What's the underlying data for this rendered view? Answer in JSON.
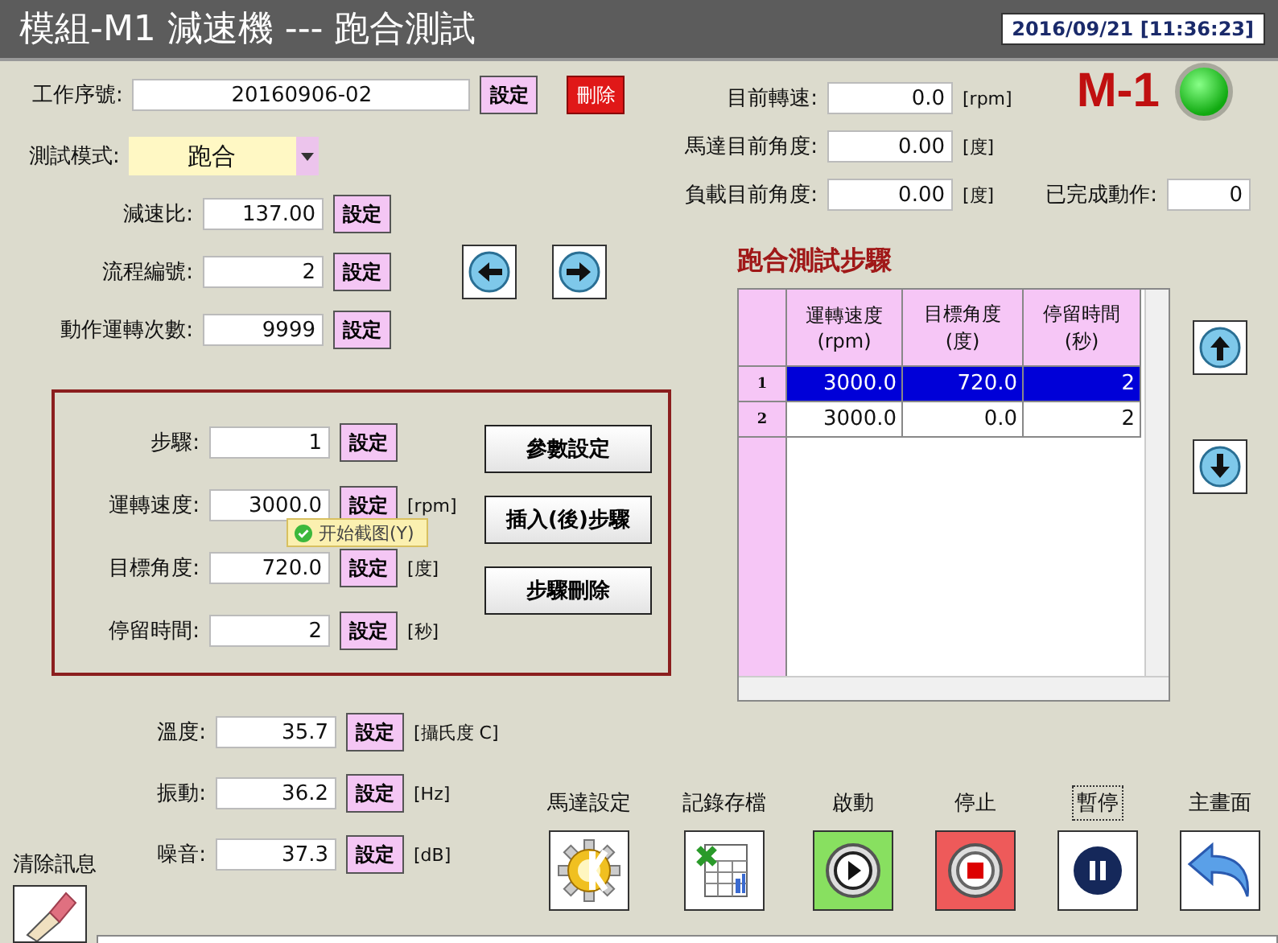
{
  "title": "模組-M1 減速機 --- 跑合測試",
  "datetime": "2016/09/21 [11:36:23]",
  "job": {
    "label": "工作序號:",
    "value": "20160906-02",
    "set_button": "設定",
    "delete_button": "刪除"
  },
  "mode": {
    "label": "測試模式:",
    "value": "跑合"
  },
  "params": [
    {
      "label": "減速比:",
      "value": "137.00",
      "button": "設定"
    },
    {
      "label": "流程編號:",
      "value": "2",
      "button": "設定"
    },
    {
      "label": "動作運轉次數:",
      "value": "9999",
      "button": "設定"
    }
  ],
  "step_box": {
    "fields": [
      {
        "label": "步驟:",
        "value": "1",
        "button": "設定"
      },
      {
        "label": "運轉速度:",
        "value": "3000.0",
        "button": "設定",
        "unit": "[rpm]"
      },
      {
        "label": "目標角度:",
        "value": "720.0",
        "button": "設定",
        "unit": "[度]"
      },
      {
        "label": "停留時間:",
        "value": "2",
        "button": "設定",
        "unit": "[秒]"
      }
    ],
    "buttons": [
      "參數設定",
      "插入(後)步驟",
      "步驟刪除"
    ],
    "tooltip": "开始截图(Y)"
  },
  "sensors": [
    {
      "label": "溫度:",
      "value": "35.7",
      "button": "設定",
      "unit": "[攝氏度 C]"
    },
    {
      "label": "振動:",
      "value": "36.2",
      "button": "設定",
      "unit": "[Hz]"
    },
    {
      "label": "噪音:",
      "value": "37.3",
      "button": "設定",
      "unit": "[dB]"
    }
  ],
  "clear_messages": {
    "label": "清除訊息"
  },
  "readings": [
    {
      "label": "目前轉速:",
      "value": "0.0",
      "unit": "[rpm]"
    },
    {
      "label": "馬達目前角度:",
      "value": "0.00",
      "unit": "[度]"
    },
    {
      "label": "負載目前角度:",
      "value": "0.00",
      "unit": "[度]"
    }
  ],
  "machine": {
    "name": "M-1",
    "online": true
  },
  "completed": {
    "label": "已完成動作:",
    "value": "0"
  },
  "steps_table": {
    "title": "跑合測試步驟",
    "columns": [
      "運轉速度\n(rpm)",
      "目標角度\n(度)",
      "停留時間\n(秒)"
    ],
    "rows": [
      {
        "index": "1",
        "cells": [
          "3000.0",
          "720.0",
          "2"
        ],
        "selected": true
      },
      {
        "index": "2",
        "cells": [
          "3000.0",
          "0.0",
          "2"
        ],
        "selected": false
      }
    ]
  },
  "toolbar": [
    {
      "label": "馬達設定",
      "kind": "motor",
      "focused": false
    },
    {
      "label": "記錄存檔",
      "kind": "save",
      "focused": false
    },
    {
      "label": "啟動",
      "kind": "start",
      "focused": false
    },
    {
      "label": "停止",
      "kind": "stop",
      "focused": false
    },
    {
      "label": "暫停",
      "kind": "pause",
      "focused": true
    },
    {
      "label": "主畫面",
      "kind": "home",
      "focused": false
    }
  ]
}
